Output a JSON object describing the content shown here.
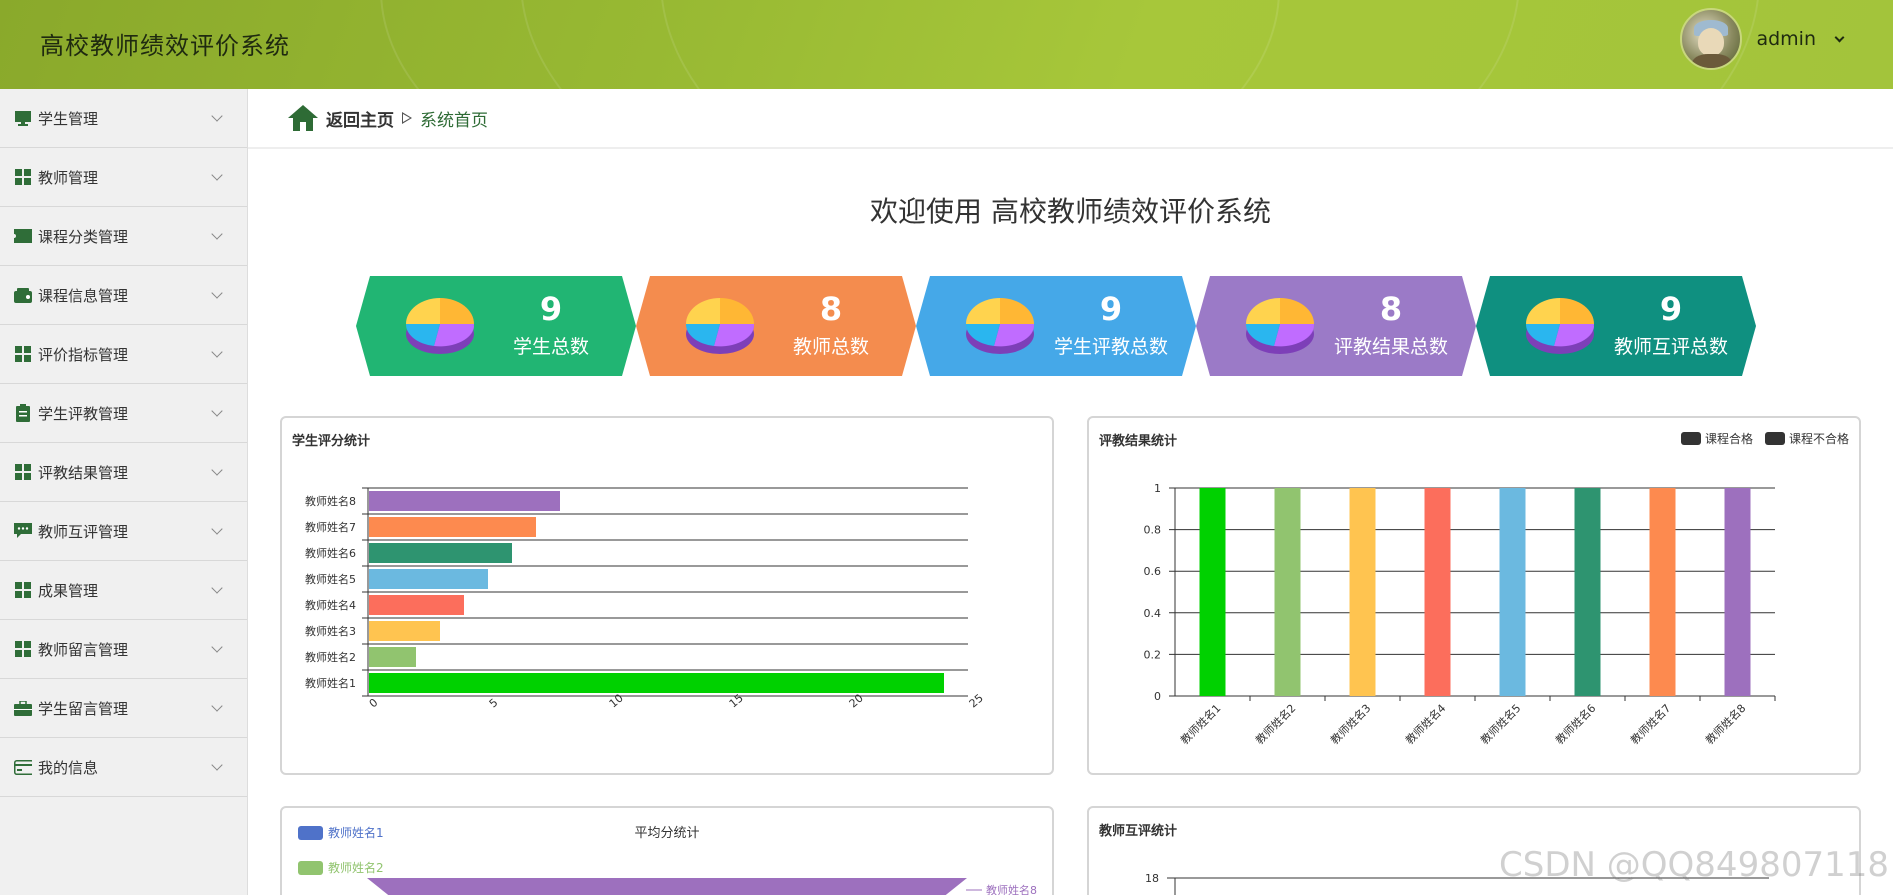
{
  "app": {
    "title": "高校教师绩效评价系统"
  },
  "user": {
    "name": "admin"
  },
  "sidebar": {
    "items": [
      {
        "label": "学生管理",
        "icon": "monitor-icon"
      },
      {
        "label": "教师管理",
        "icon": "grid-icon"
      },
      {
        "label": "课程分类管理",
        "icon": "ticket-icon"
      },
      {
        "label": "课程信息管理",
        "icon": "wallet-icon"
      },
      {
        "label": "评价指标管理",
        "icon": "grid-icon"
      },
      {
        "label": "学生评教管理",
        "icon": "clipboard-icon"
      },
      {
        "label": "评教结果管理",
        "icon": "grid-icon"
      },
      {
        "label": "教师互评管理",
        "icon": "chat-icon"
      },
      {
        "label": "成果管理",
        "icon": "grid-icon"
      },
      {
        "label": "教师留言管理",
        "icon": "grid-icon"
      },
      {
        "label": "学生留言管理",
        "icon": "briefcase-icon"
      },
      {
        "label": "我的信息",
        "icon": "card-icon"
      }
    ]
  },
  "breadcrumb": {
    "home": "返回主页",
    "current": "系统首页"
  },
  "welcome": "欢迎使用 高校教师绩效评价系统",
  "stats": [
    {
      "value": "9",
      "label": "学生总数",
      "color": "#21b573"
    },
    {
      "value": "8",
      "label": "教师总数",
      "color": "#f48c4e"
    },
    {
      "value": "9",
      "label": "学生评教总数",
      "color": "#45a8e8"
    },
    {
      "value": "8",
      "label": "评教结果总数",
      "color": "#9b7ac7"
    },
    {
      "value": "9",
      "label": "教师互评总数",
      "color": "#0f9080"
    }
  ],
  "chart_data": [
    {
      "type": "bar",
      "orientation": "horizontal",
      "title": "学生评分统计",
      "categories": [
        "教师姓名1",
        "教师姓名2",
        "教师姓名3",
        "教师姓名4",
        "教师姓名5",
        "教师姓名6",
        "教师姓名7",
        "教师姓名8"
      ],
      "values": [
        24,
        2,
        3,
        4,
        5,
        6,
        7,
        8
      ],
      "colors": [
        "#00d100",
        "#91c46f",
        "#ffc450",
        "#fc6e5c",
        "#6bb9e0",
        "#2e9470",
        "#fd8a4f",
        "#9d70be"
      ],
      "xticks": [
        "0",
        "5",
        "10",
        "15",
        "20",
        "25"
      ],
      "xlim": [
        0,
        25
      ]
    },
    {
      "type": "bar",
      "title": "评教结果统计",
      "categories": [
        "教师姓名1",
        "教师姓名2",
        "教师姓名3",
        "教师姓名4",
        "教师姓名5",
        "教师姓名6",
        "教师姓名7",
        "教师姓名8"
      ],
      "values": [
        1,
        1,
        1,
        1,
        1,
        1,
        1,
        1
      ],
      "colors": [
        "#00d100",
        "#91c46f",
        "#ffc450",
        "#fc6e5c",
        "#6bb9e0",
        "#2e9470",
        "#fd8a4f",
        "#9d70be"
      ],
      "yticks": [
        "0",
        "0.2",
        "0.4",
        "0.6",
        "0.8",
        "1"
      ],
      "ylim": [
        0,
        1
      ],
      "legend": [
        "课程合格",
        "课程不合格"
      ],
      "legend_color": "#333333"
    },
    {
      "type": "funnel",
      "title": "平均分统计",
      "legend": [
        {
          "name": "教师姓名1",
          "color": "#4f72c9"
        },
        {
          "name": "教师姓名2",
          "color": "#91c46f"
        }
      ],
      "label": "教师姓名8",
      "label_color": "#9d70be"
    },
    {
      "type": "bar",
      "title": "教师互评统计",
      "yticks": [
        "18"
      ]
    }
  ],
  "watermark": "CSDN @QQ849807118"
}
